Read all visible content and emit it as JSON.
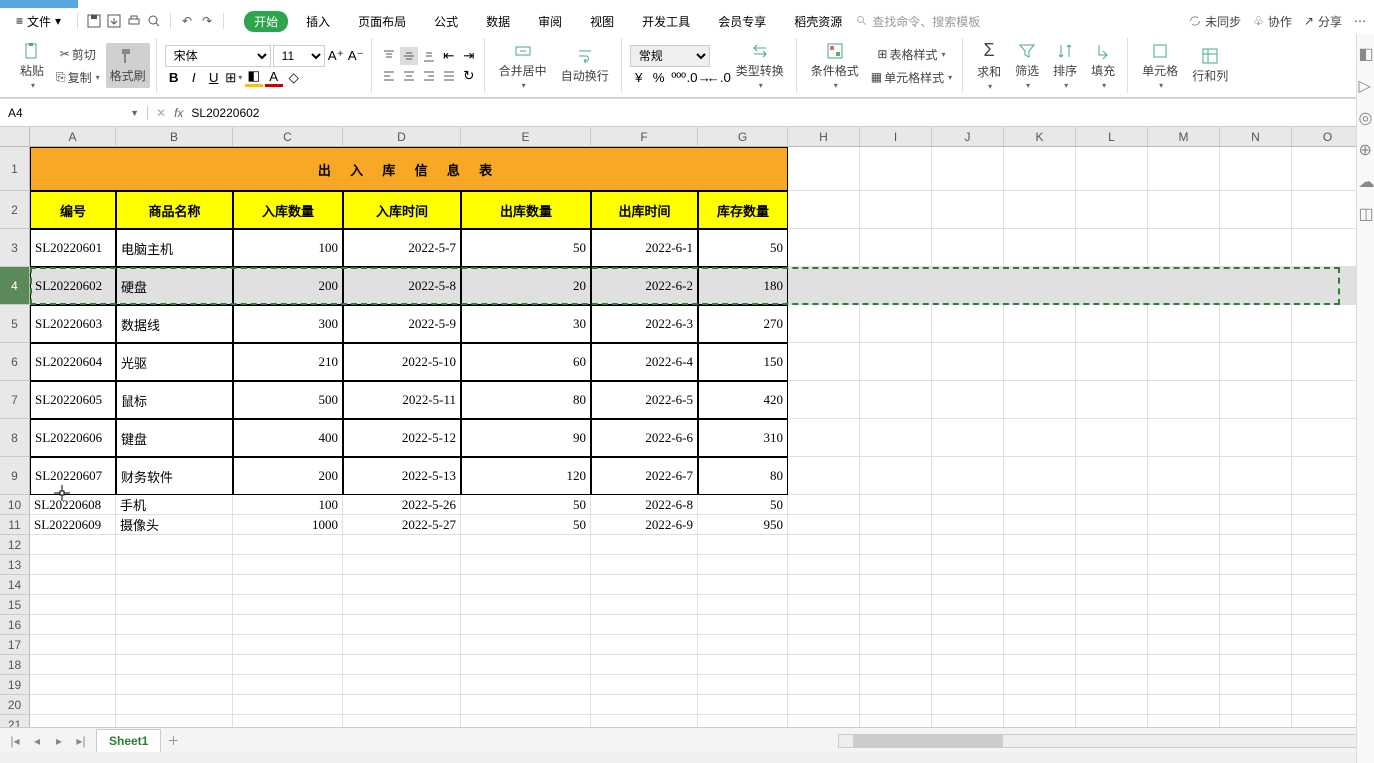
{
  "menubar": {
    "file": "文件",
    "tabs": [
      "开始",
      "插入",
      "页面布局",
      "公式",
      "数据",
      "审阅",
      "视图",
      "开发工具",
      "会员专享",
      "稻壳资源"
    ],
    "search_placeholder": "查找命令、搜索模板",
    "right": {
      "unsync": "未同步",
      "collab": "协作",
      "share": "分享"
    }
  },
  "ribbon": {
    "paste": "粘贴",
    "cut": "剪切",
    "copy": "复制",
    "fmtpaint": "格式刷",
    "font": "宋体",
    "fontsize": "11",
    "merge": "合并居中",
    "wrap": "自动换行",
    "numfmt": "常规",
    "typeconv": "类型转换",
    "condfmt": "条件格式",
    "tablestyle": "表格样式",
    "cellstyle": "单元格样式",
    "sum": "求和",
    "filter": "筛选",
    "sort": "排序",
    "fill": "填充",
    "cells": "单元格",
    "rowcol": "行和列"
  },
  "namebox": "A4",
  "formula": "SL20220602",
  "columns": [
    "A",
    "B",
    "C",
    "D",
    "E",
    "F",
    "G",
    "H",
    "I",
    "J",
    "K",
    "L",
    "M",
    "N",
    "O"
  ],
  "title": "出 入 库 信 息 表",
  "headers": [
    "编号",
    "商品名称",
    "入库数量",
    "入库时间",
    "出库数量",
    "出库时间",
    "库存数量"
  ],
  "rows": [
    {
      "id": "SL20220601",
      "name": "电脑主机",
      "in_qty": 100,
      "in_date": "2022-5-7",
      "out_qty": 50,
      "out_date": "2022-6-1",
      "stock": 50
    },
    {
      "id": "SL20220602",
      "name": "硬盘",
      "in_qty": 200,
      "in_date": "2022-5-8",
      "out_qty": 20,
      "out_date": "2022-6-2",
      "stock": 180
    },
    {
      "id": "SL20220603",
      "name": "数据线",
      "in_qty": 300,
      "in_date": "2022-5-9",
      "out_qty": 30,
      "out_date": "2022-6-3",
      "stock": 270
    },
    {
      "id": "SL20220604",
      "name": "光驱",
      "in_qty": 210,
      "in_date": "2022-5-10",
      "out_qty": 60,
      "out_date": "2022-6-4",
      "stock": 150
    },
    {
      "id": "SL20220605",
      "name": "鼠标",
      "in_qty": 500,
      "in_date": "2022-5-11",
      "out_qty": 80,
      "out_date": "2022-6-5",
      "stock": 420
    },
    {
      "id": "SL20220606",
      "name": "键盘",
      "in_qty": 400,
      "in_date": "2022-5-12",
      "out_qty": 90,
      "out_date": "2022-6-6",
      "stock": 310
    },
    {
      "id": "SL20220607",
      "name": "财务软件",
      "in_qty": 200,
      "in_date": "2022-5-13",
      "out_qty": 120,
      "out_date": "2022-6-7",
      "stock": 80
    },
    {
      "id": "SL20220608",
      "name": "手机",
      "in_qty": 100,
      "in_date": "2022-5-26",
      "out_qty": 50,
      "out_date": "2022-6-8",
      "stock": 50
    },
    {
      "id": "SL20220609",
      "name": "摄像头",
      "in_qty": 1000,
      "in_date": "2022-5-27",
      "out_qty": 50,
      "out_date": "2022-6-9",
      "stock": 950
    }
  ],
  "sheet_tab": "Sheet1",
  "selected_row_index": 1,
  "col_widths": {
    "A": 86,
    "B": 117,
    "C": 110,
    "D": 118,
    "E": 130,
    "F": 107,
    "G": 90
  }
}
